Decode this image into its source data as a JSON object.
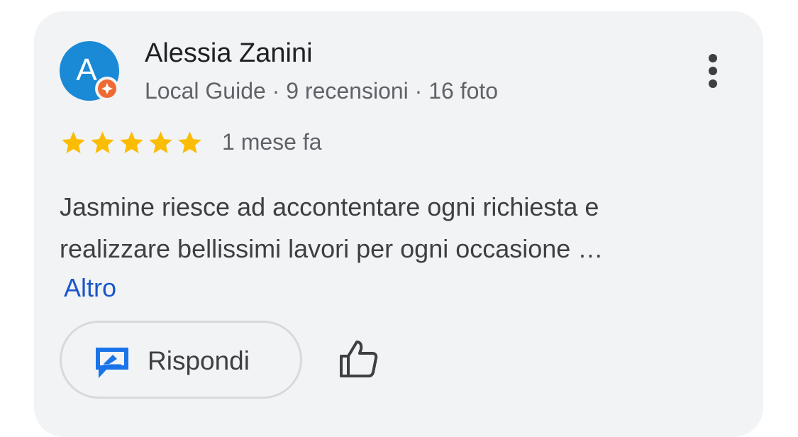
{
  "review": {
    "avatar_letter": "A",
    "reviewer_name": "Alessia Zanini",
    "reviewer_meta": "Local Guide · 9 recensioni · 16 foto",
    "rating": 5,
    "date": "1 mese fa",
    "text_lines": [
      "Jasmine riesce ad accontentare ogni richiesta e",
      "realizzare bellissimi lavori per ogni occasione …"
    ],
    "more_label": "Altro"
  },
  "actions": {
    "reply_label": "Rispondi",
    "like_icon": "thumbs-up-icon",
    "menu_icon": "more-vertical-icon"
  },
  "colors": {
    "card_background": "#f2f3f5",
    "avatar": "#1a89d6",
    "local_guide_badge": "#ee6a35",
    "star": "#fbbc04",
    "link": "#1a57c8",
    "reply_icon": "#1a73e8"
  }
}
